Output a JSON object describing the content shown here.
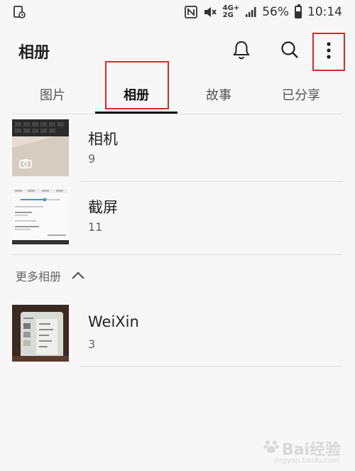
{
  "status_bar": {
    "battery_percent_label": "56%",
    "battery_level": 0.56,
    "time": "10:14",
    "network_top": "4G+",
    "network_bottom": "2G",
    "icons": [
      "screen-record-icon",
      "nfc-icon",
      "mute-icon",
      "signal-icon",
      "battery-icon"
    ]
  },
  "app_bar": {
    "title": "相册",
    "actions": [
      "bell-icon",
      "search-icon",
      "more-vert-icon"
    ]
  },
  "tabs": [
    "图片",
    "相册",
    "故事",
    "已分享"
  ],
  "selected_tab": "相册",
  "albums": [
    {
      "name": "相机",
      "count": "9",
      "icon": "camera-icon"
    },
    {
      "name": "截屏",
      "count": "11"
    }
  ],
  "more_section": {
    "title": "更多相册",
    "icon": "chevron-up-icon",
    "albums": [
      {
        "name": "WeiXin",
        "count": "3"
      }
    ]
  },
  "watermark": {
    "text": "Bai经验",
    "url": "jingyan.baidu.com"
  },
  "colors": {
    "highlight": "#d92b2b",
    "background": "#f7f7f7"
  }
}
